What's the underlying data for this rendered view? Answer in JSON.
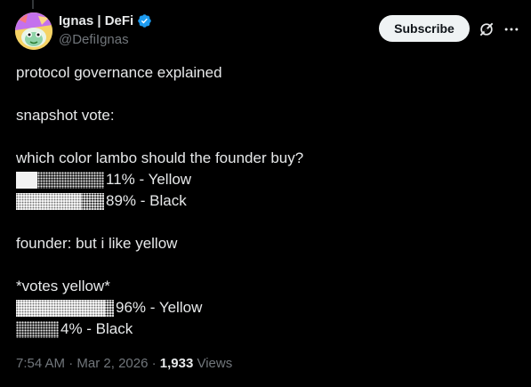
{
  "author": {
    "display_name": "Ignas | DeFi",
    "handle": "@DefiIgnas",
    "verified_color": "#1d9bf0"
  },
  "header": {
    "subscribe_label": "Subscribe",
    "grok_icon": "grok-icon",
    "more_icon": "more-icon"
  },
  "tweet": {
    "line1": "protocol governance explained",
    "line2": "snapshot vote:",
    "line3": "which color lambo should the founder buy?",
    "poll1": [
      {
        "percent": 11,
        "label": "11% - Yellow"
      },
      {
        "percent": 89,
        "label": "89% - Black"
      }
    ],
    "line4": "founder: but i like yellow",
    "line5": "*votes yellow*",
    "poll2": [
      {
        "percent": 96,
        "label": "96% - Yellow"
      },
      {
        "percent": 4,
        "label": "4% - Black"
      }
    ]
  },
  "meta": {
    "time": "7:54 AM",
    "separator1": " · ",
    "date": "Mar 2, 2026",
    "separator2": " · ",
    "views_count": "1,933",
    "views_label": " Views"
  }
}
